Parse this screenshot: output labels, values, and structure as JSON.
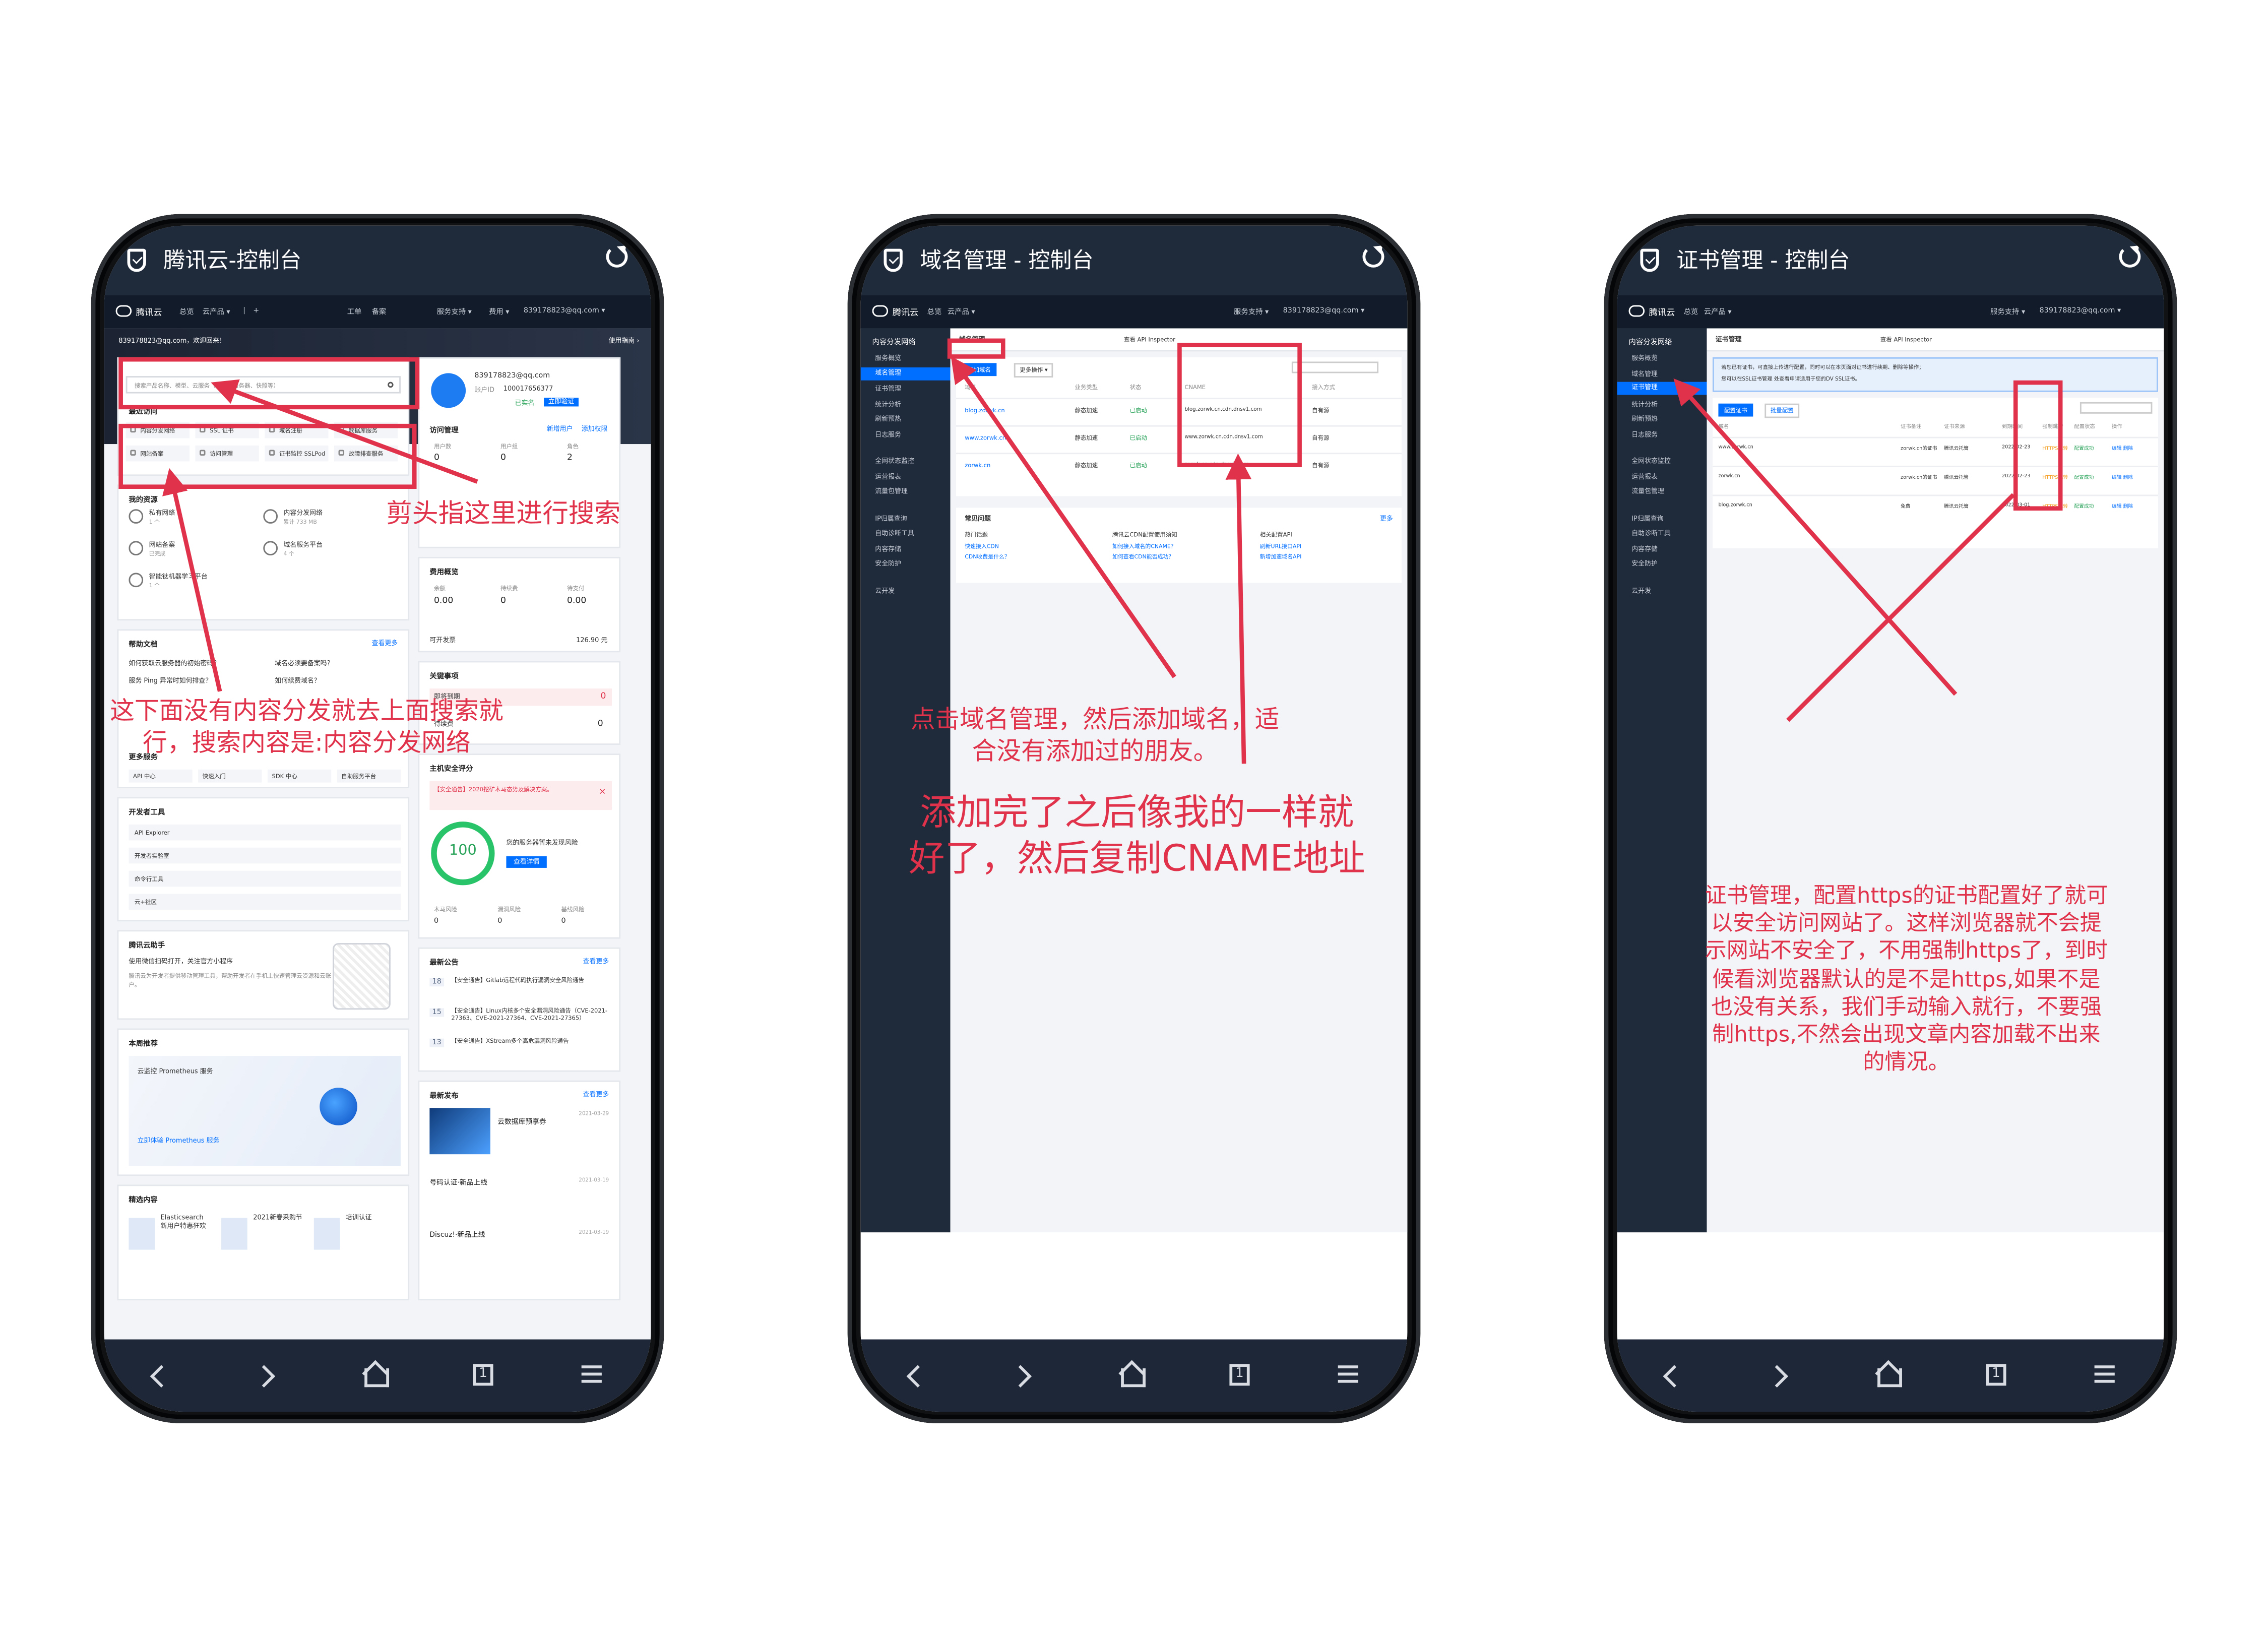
{
  "phones": [
    {
      "title": "腾讯云-控制台",
      "topbar": {
        "brand": "腾讯云",
        "nav": [
          "总览",
          "云产品 ▾",
          "|",
          "+"
        ],
        "right": [
          "工单",
          "备案",
          "服务支持 ▾",
          "费用 ▾",
          "839178823@qq.com ▾"
        ]
      },
      "console": {
        "account": "839178823@qq.com，欢迎回来！",
        "use_guide": "使用指南 ›",
        "search_placeholder": "搜索产品名称、模型、云服务（如：云服务器、快照等）",
        "recent_title": "最近访问",
        "recent": [
          "内容分发网络",
          "SSL 证书",
          "域名注册",
          "数据库服务",
          "网站备案",
          "访问管理",
          "证书监控 SSLPod",
          "故障排查服务"
        ],
        "resources_title": "我的资源",
        "resources": [
          {
            "name": "私有网络",
            "sub": "1 个"
          },
          {
            "name": "内容分发网络",
            "sub": "累计 733 MB"
          },
          {
            "name": "网站备案",
            "sub": "已完成"
          },
          {
            "name": "域名服务平台",
            "sub": "4 个"
          },
          {
            "name": "智能钛机器学习平台",
            "sub": "1 个"
          }
        ],
        "help_title": "帮助文档",
        "help_more": "查看更多",
        "help_items": [
          "如何获取云服务器的初始密码？",
          "域名必须要备案吗？",
          "服务 Ping 异常时如何排查？",
          "如何续费域名？"
        ],
        "more_services_title": "更多服务",
        "more_services": [
          "API 中心",
          "快速入门",
          "SDK 中心",
          "自助服务平台"
        ],
        "dev_tools_title": "开发者工具",
        "dev_tools": [
          "API Explorer",
          "开发者实验室",
          "命令行工具",
          "云+社区"
        ],
        "assistant_title": "腾讯云助手",
        "assistant_text": "使用微信扫码打开，关注官方小程序",
        "assistant_desc": "腾讯云为开发者提供移动管理工具，帮助开发者在手机上快速管理云资源和云账户。",
        "weekly_title": "本周推荐",
        "weekly_card_title": "云监控 Prometheus 服务",
        "weekly_link": "立即体验 Prometheus 服务",
        "featured_title": "精选内容",
        "featured": [
          "Elasticsearch 新用户特惠狂欢",
          "2021新春采购节",
          "培训认证"
        ],
        "user_id": "839178823@qq.com",
        "user_account_label": "账户ID",
        "user_account": "100017656377",
        "user_status": "已实名",
        "user_btn": "立即验证",
        "access_title": "访问管理",
        "access_links": [
          "新增用户",
          "添加权限"
        ],
        "access_stats": [
          {
            "label": "用户数",
            "value": "0"
          },
          {
            "label": "用户组",
            "value": "0"
          },
          {
            "label": "角色",
            "value": "2"
          }
        ],
        "cost_title": "费用概览",
        "cost_stats": [
          {
            "label": "余额",
            "value": "0.00"
          },
          {
            "label": "待续费",
            "value": "0"
          },
          {
            "label": "待支付",
            "value": "0.00"
          }
        ],
        "cost_footer": "可开发票",
        "cost_value": "126.90 元",
        "key_title": "关键事项",
        "key_items": [
          {
            "label": "即将到期",
            "value": "0"
          },
          {
            "label": "待续费",
            "value": "0"
          }
        ],
        "security_title": "主机安全评分",
        "security_alert": "【安全通告】2020挖矿木马态势及解决方案。",
        "security_score": "100",
        "security_text": "您的服务器暂未发现风险",
        "security_btn": "查看详情",
        "security_stats": [
          {
            "label": "木马风险",
            "value": "0"
          },
          {
            "label": "漏洞风险",
            "value": "0"
          },
          {
            "label": "基线风险",
            "value": "0"
          }
        ],
        "notice_title": "最新公告",
        "notice_more": "查看更多",
        "notices": [
          {
            "date": "18",
            "text": "【安全通告】Gitlab远程代码执行漏洞安全风险通告"
          },
          {
            "date": "15",
            "text": "【安全通告】Linux内核多个安全漏洞风险通告（CVE-2021-27363、CVE-2021-27364、CVE-2021-27365）"
          },
          {
            "date": "13",
            "text": "【安全通告】XStream多个高危漏洞风险通告"
          }
        ],
        "release_title": "最新发布",
        "release_more": "查看更多",
        "releases": [
          {
            "title": "云数据库预享券",
            "date": "2021-03-29"
          },
          {
            "title": "号码认证·新品上线",
            "date": "2021-03-19"
          },
          {
            "title": "Discuz!·新品上线",
            "date": "2021-03-19"
          }
        ]
      },
      "annotations": [
        "剪头指这里进行搜索",
        "这下面没有内容分发就去上面搜索就行，搜索内容是:内容分发网络"
      ]
    },
    {
      "title": "域名管理 - 控制台",
      "sidebar_title": "内容分发网络",
      "sidebar": [
        "服务概览",
        "域名管理",
        "证书管理",
        "统计分析",
        "刷新预热",
        "日志服务",
        "全网状态监控",
        "运营报表",
        "流量包管理",
        "IP归属查询",
        "自助诊断工具",
        "内容存储",
        "安全防护",
        "云开发"
      ],
      "page_title": "域名管理",
      "api_tab": "查看 API Inspector",
      "add_button": "添加域名",
      "more_ops": "更多操作 ▾",
      "columns": [
        "域名",
        "业务类型",
        "状态",
        "CNAME",
        "接入方式"
      ],
      "rows": [
        {
          "domain": "blog.zorwk.cn",
          "type": "静态加速",
          "status": "已启动",
          "cname": "blog.zorwk.cn.cdn.dnsv1.com",
          "access": "自有源"
        },
        {
          "domain": "www.zorwk.cn",
          "type": "静态加速",
          "status": "已启动",
          "cname": "www.zorwk.cn.cdn.dnsv1.com",
          "access": "自有源"
        },
        {
          "domain": "zorwk.cn",
          "type": "静态加速",
          "status": "已启动",
          "cname": "zorwk.cn.cdn.dnsv1.com",
          "access": "自有源"
        }
      ],
      "faq_title": "常见问题",
      "faq_more": "更多",
      "faq_cols": [
        {
          "title": "热门话题",
          "items": [
            "快速接入CDN",
            "CDN收费是什么？"
          ]
        },
        {
          "title": "腾讯云CDN配置使用须知",
          "items": [
            "如何接入域名的CNAME？",
            "如何查看CDN能否成功？"
          ]
        },
        {
          "title": "相关配置API",
          "items": [
            "刷新URL接口API",
            "新增加速域名API"
          ]
        }
      ],
      "annotations": [
        "点击域名管理，然后添加域名，适合没有添加过的朋友。",
        "添加完了之后像我的一样就好了，然后复制CNAME地址"
      ]
    },
    {
      "title": "证书管理 - 控制台",
      "sidebar_title": "内容分发网络",
      "sidebar": [
        "服务概览",
        "域名管理",
        "证书管理",
        "统计分析",
        "刷新预热",
        "日志服务",
        "全网状态监控",
        "运营报表",
        "流量包管理",
        "IP归属查询",
        "自助诊断工具",
        "内容存储",
        "安全防护",
        "云开发"
      ],
      "page_title": "证书管理",
      "api_tab": "查看 API Inspector",
      "notice": [
        "若您已有证书，可直接上传进行配置，同时可以在本页面对证书进行续期、删除等操作；",
        "您可以在SSL证书管理 处查看申请适用于您的DV SSL证书。"
      ],
      "buttons": [
        "配置证书",
        "批量配置"
      ],
      "columns": [
        "域名",
        "证书备注",
        "证书来源",
        "到期时间",
        "强制跳转",
        "配置状态",
        "操作"
      ],
      "rows": [
        {
          "domain": "www.zorwk.cn",
          "remark": "zorwk.cn的证书",
          "source": "腾讯云托管",
          "expire": "2022-02-23",
          "force": "HTTPS跳转",
          "state": "配置成功",
          "ops": "编辑 删除"
        },
        {
          "domain": "zorwk.cn",
          "remark": "zorwk.cn的证书",
          "source": "腾讯云托管",
          "expire": "2022-02-23",
          "force": "HTTPS跳转",
          "state": "配置成功",
          "ops": "编辑 删除"
        },
        {
          "domain": "blog.zorwk.cn",
          "remark": "免费",
          "source": "腾讯云托管",
          "expire": "2022-03-01",
          "force": "HTTPS跳转",
          "state": "配置成功",
          "ops": "编辑 删除"
        }
      ],
      "annotation": "证书管理，配置https的证书配置好了就可以安全访问网站了。这样浏览器就不会提示网站不安全了，不用强制https了，到时候看浏览器默认的是不是https,如果不是也没有关系，我们手动输入就行，不要强制https,不然会出现文章内容加载不出来的情况。"
    }
  ],
  "colors": {
    "annotation_red": "#e0324a",
    "accent_blue": "#006eff",
    "title_bar": "#1f2a3b",
    "sidebar": "#1f2a3b"
  }
}
